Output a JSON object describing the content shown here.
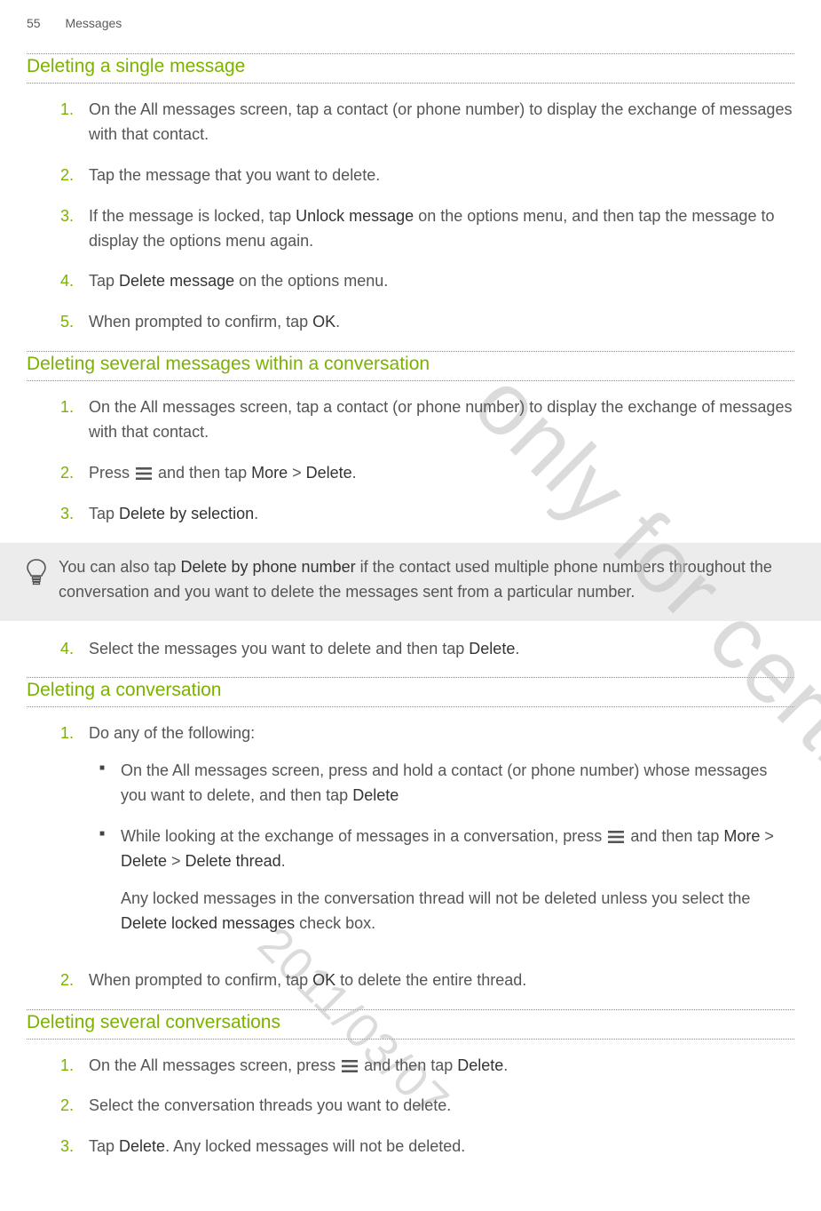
{
  "header": {
    "page_number": "55",
    "chapter": "Messages"
  },
  "watermark": {
    "big": "only for certification",
    "date": "2011/03/07"
  },
  "sections": [
    {
      "title": "Deleting a single message",
      "steps": [
        {
          "parts": [
            "On the All messages screen, tap a contact (or phone number) to display the exchange of messages with that contact."
          ]
        },
        {
          "parts": [
            "Tap the message that you want to delete."
          ]
        },
        {
          "parts": [
            "If the message is locked, tap ",
            {
              "b": "Unlock message"
            },
            " on the options menu, and then tap the message to display the options menu again."
          ]
        },
        {
          "parts": [
            "Tap ",
            {
              "b": "Delete message"
            },
            " on the options menu."
          ]
        },
        {
          "parts": [
            "When prompted to confirm, tap ",
            {
              "b": "OK"
            },
            "."
          ]
        }
      ]
    },
    {
      "title": "Deleting several messages within a conversation",
      "steps": [
        {
          "parts": [
            "On the All messages screen, tap a contact (or phone number) to display the exchange of messages with that contact."
          ]
        },
        {
          "parts": [
            "Press ",
            {
              "icon": "menu"
            },
            " and then tap ",
            {
              "b": "More"
            },
            " > ",
            {
              "b": "Delete"
            },
            "."
          ]
        },
        {
          "parts": [
            "Tap ",
            {
              "b": "Delete by selection"
            },
            "."
          ]
        }
      ],
      "tip": {
        "parts": [
          "You can also tap ",
          {
            "b": "Delete by phone number"
          },
          " if the contact used multiple phone numbers throughout the conversation and you want to delete the messages sent from a particular number."
        ]
      },
      "steps_after": [
        {
          "num": "4",
          "parts": [
            "Select the messages you want to delete and then tap ",
            {
              "b": "Delete"
            },
            "."
          ]
        }
      ]
    },
    {
      "title": "Deleting a conversation",
      "steps": [
        {
          "parts": [
            "Do any of the following:"
          ],
          "bullets": [
            {
              "parts": [
                "On the All messages screen, press and hold a contact (or phone number) whose messages you want to delete, and then tap ",
                {
                  "b": "Delete"
                }
              ]
            },
            {
              "parts": [
                "While looking at the exchange of messages in a conversation, press ",
                {
                  "icon": "menu"
                },
                " and then tap ",
                {
                  "b": "More"
                },
                " > ",
                {
                  "b": "Delete"
                },
                " > ",
                {
                  "b": "Delete thread"
                },
                "."
              ],
              "note": {
                "parts": [
                  "Any locked messages in the conversation thread will not be deleted unless you select the ",
                  {
                    "b": "Delete locked messages"
                  },
                  " check box."
                ]
              }
            }
          ]
        },
        {
          "parts": [
            "When prompted to confirm, tap ",
            {
              "b": "OK"
            },
            " to delete the entire thread."
          ]
        }
      ]
    },
    {
      "title": "Deleting several conversations",
      "steps": [
        {
          "parts": [
            "On the All messages screen, press ",
            {
              "icon": "menu"
            },
            " and then tap ",
            {
              "b": "Delete"
            },
            "."
          ]
        },
        {
          "parts": [
            "Select the conversation threads you want to delete."
          ]
        },
        {
          "parts": [
            "Tap ",
            {
              "b": "Delete"
            },
            ". Any locked messages will not be deleted."
          ]
        }
      ]
    }
  ]
}
